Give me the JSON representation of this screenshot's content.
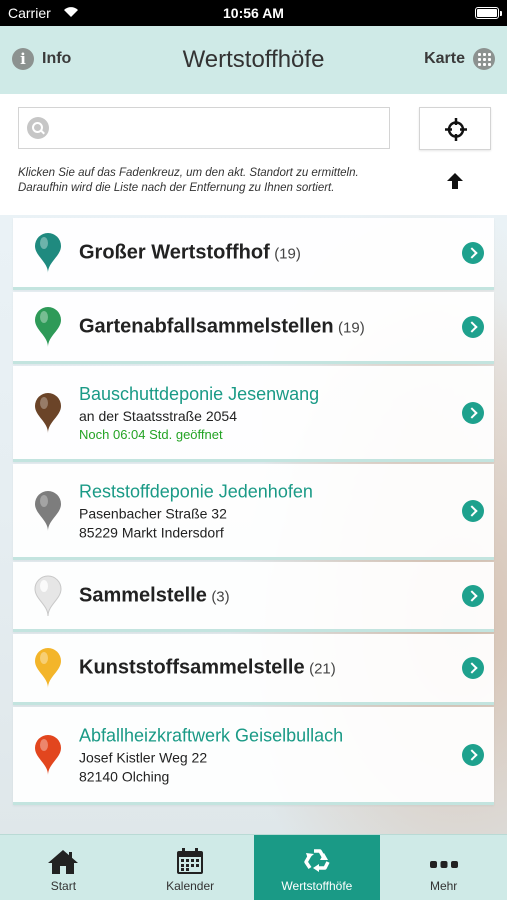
{
  "status_bar": {
    "carrier": "Carrier",
    "time": "10:56 AM"
  },
  "navbar": {
    "info_label": "Info",
    "title": "Wertstoffhöfe",
    "map_label": "Karte"
  },
  "search": {
    "placeholder": "",
    "value": ""
  },
  "hint": "Klicken Sie auf das Fadenkreuz, um den akt. Standort zu ermitteln. Daraufhin wird die Liste nach der Entfernung zu Ihnen sortiert.",
  "items": [
    {
      "title": "Großer Wertstoffhof",
      "count": "(19)",
      "pin_color": "#1f8a7f"
    },
    {
      "title": "Gartenabfallsammelstellen",
      "count": "(19)",
      "pin_color": "#2e9a58"
    },
    {
      "title": "Bauschuttdeponie Jesenwang",
      "line1": "an der Staatsstraße 2054",
      "line2": "Noch 06:04 Std. geöffnet",
      "pin_color": "#6b4428"
    },
    {
      "title": "Reststoffdeponie Jedenhofen",
      "line1": "Pasenbacher Straße 32",
      "line2": "85229 Markt Indersdorf",
      "pin_color": "#7d7d7d"
    },
    {
      "title": "Sammelstelle",
      "count": "(3)",
      "pin_color": "#e6e6e6"
    },
    {
      "title": "Kunststoffsammelstelle",
      "count": "(21)",
      "pin_color": "#f3b52a"
    },
    {
      "title": "Abfallheizkraftwerk Geiselbullach",
      "line1": "Josef Kistler Weg 22",
      "line2": "82140 Olching",
      "pin_color": "#e2461e"
    }
  ],
  "tabs": [
    {
      "label": "Start",
      "icon": "home-icon"
    },
    {
      "label": "Kalender",
      "icon": "calendar-icon"
    },
    {
      "label": "Wertstoffhöfe",
      "icon": "recycle-icon",
      "active": true
    },
    {
      "label": "Mehr",
      "icon": "more-icon"
    }
  ],
  "colors": {
    "accent": "#1a9a86",
    "header_bg": "#cfeae7",
    "open_status": "#24a324"
  }
}
